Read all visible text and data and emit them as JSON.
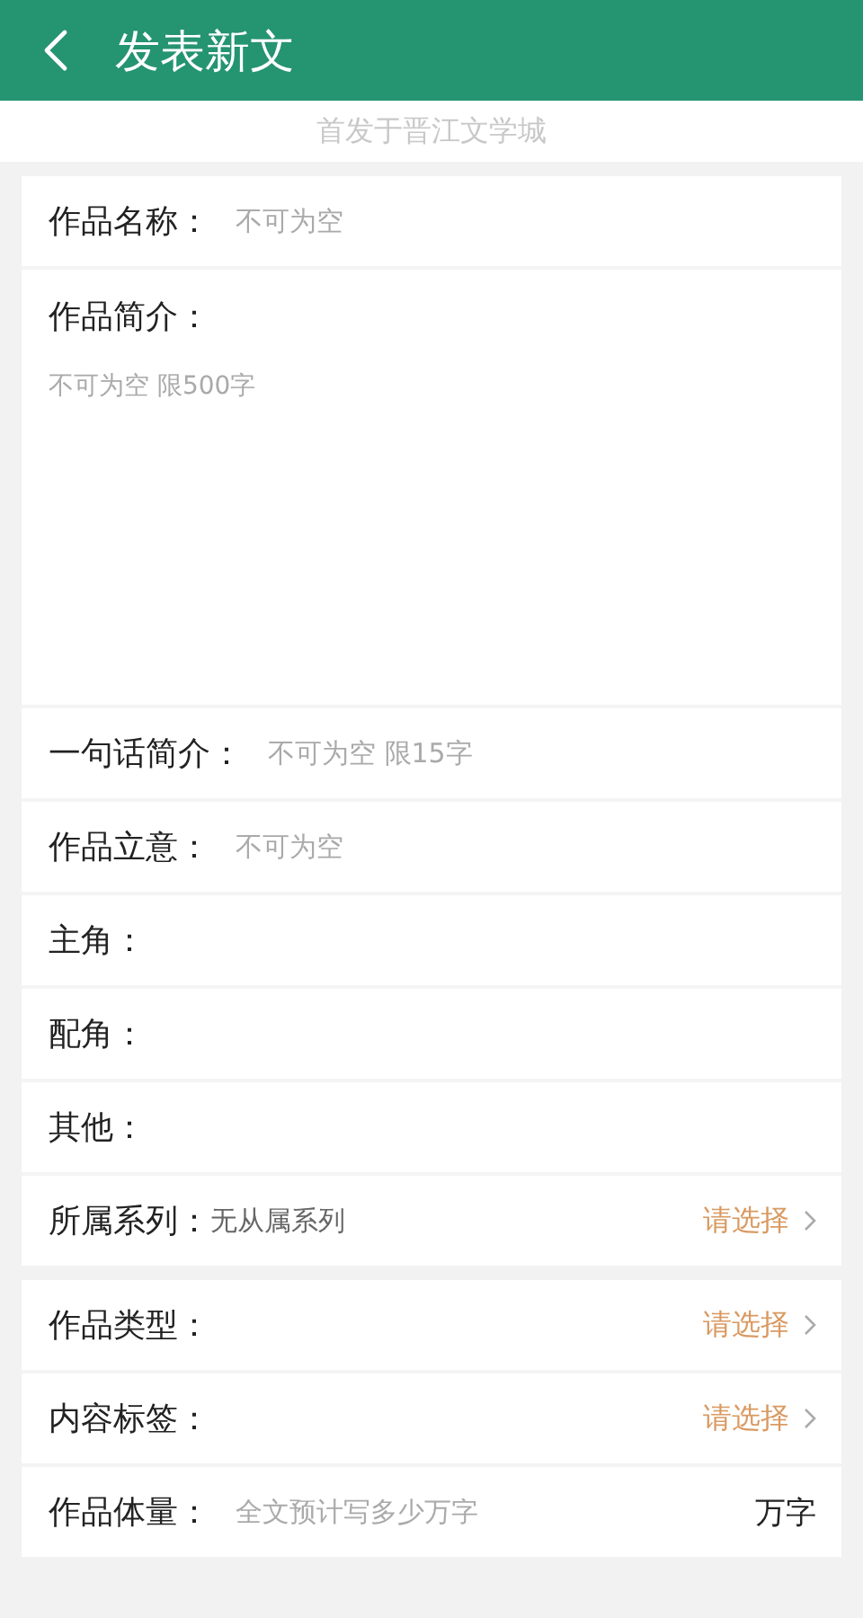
{
  "header": {
    "title": "发表新文"
  },
  "subtitle": "首发于晋江文学城",
  "sections": [
    {
      "rows": [
        {
          "kind": "input",
          "label": "作品名称：",
          "placeholder": "不可为空"
        },
        {
          "kind": "textarea",
          "label": "作品简介：",
          "placeholder": "不可为空 限500字"
        },
        {
          "kind": "input",
          "label": "一句话简介：",
          "placeholder": "不可为空 限15字"
        },
        {
          "kind": "input",
          "label": "作品立意：",
          "placeholder": "不可为空"
        },
        {
          "kind": "plain",
          "label": "主角："
        },
        {
          "kind": "plain",
          "label": "配角："
        },
        {
          "kind": "plain",
          "label": "其他："
        },
        {
          "kind": "select",
          "label": "所属系列：",
          "value": "无从属系列",
          "action": "请选择"
        }
      ]
    },
    {
      "rows": [
        {
          "kind": "select",
          "label": "作品类型：",
          "action": "请选择"
        },
        {
          "kind": "select",
          "label": "内容标签：",
          "action": "请选择"
        },
        {
          "kind": "input",
          "label": "作品体量：",
          "placeholder": "全文预计写多少万字",
          "unit": "万字"
        }
      ]
    }
  ]
}
